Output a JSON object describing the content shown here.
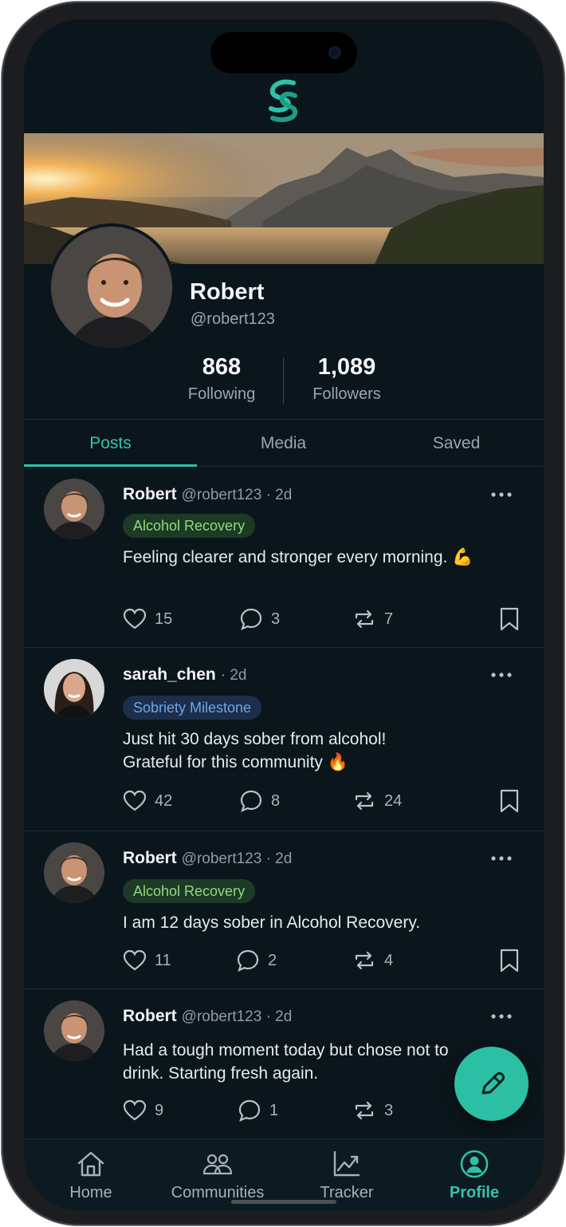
{
  "profile": {
    "name": "Robert",
    "handle": "@robert123",
    "following_count": "868",
    "following_label": "Following",
    "followers_count": "1,089",
    "followers_label": "Followers"
  },
  "tabs": [
    {
      "label": "Posts",
      "active": true
    },
    {
      "label": "Media",
      "active": false
    },
    {
      "label": "Saved",
      "active": false
    }
  ],
  "posts": [
    {
      "author": "Robert",
      "meta": "@robert123 · 2d",
      "tag": "Alcohol Recovery",
      "body": "Feeling clearer and stronger every morning. 💪",
      "likes": "15",
      "comments": "3",
      "reposts": "7"
    },
    {
      "author": "sarah_chen",
      "meta": "· 2d",
      "tag": "Sobriety Milestone",
      "body": "Just hit 30 days sober from alcohol! Grateful for this community 🔥",
      "likes": "42",
      "comments": "8",
      "reposts": "24"
    },
    {
      "author": "Robert",
      "meta": "@robert123 · 2d",
      "tag": "Alcohol Recovery",
      "body": "I am 12 days sober in Alcohol Recovery.",
      "likes": "11",
      "comments": "2",
      "reposts": "4"
    },
    {
      "author": "Robert",
      "meta": "@robert123 · 2d",
      "body": "Had a tough moment today but chose not to drink. Starting fresh again.",
      "likes": "9",
      "comments": "1",
      "reposts": "3"
    }
  ],
  "nav": [
    {
      "label": "Home",
      "icon": "home-icon"
    },
    {
      "label": "Communities",
      "icon": "communities-icon"
    },
    {
      "label": "Tracker",
      "icon": "tracker-icon"
    },
    {
      "label": "Profile",
      "icon": "profile-icon",
      "active": true
    }
  ],
  "colors": {
    "accent": "#2fc0a6",
    "background": "#0b161c",
    "tag_green_bg": "#1d3a26",
    "tag_blue_bg": "#1c2e4a"
  },
  "fab": {
    "icon": "pencil-icon"
  }
}
